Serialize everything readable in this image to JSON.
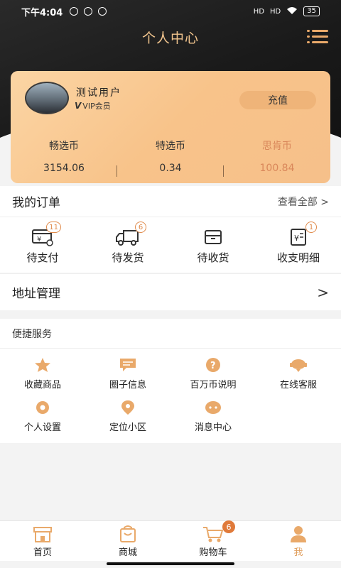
{
  "status": {
    "time": "下午4:04",
    "battery": "35",
    "signal1": "HD",
    "signal2": "HD"
  },
  "header": {
    "title": "个人中心"
  },
  "colors": {
    "accent": "#e9a96a",
    "card": "#f8c38a",
    "third_coin": "#d9875a",
    "badge": "#e07a3a"
  },
  "user": {
    "name": "测试用户",
    "vip_label": "VIP会员",
    "recharge_label": "充值"
  },
  "coins": [
    {
      "name": "畅选币",
      "value": "3154.06"
    },
    {
      "name": "特选币",
      "value": "0.34"
    },
    {
      "name": "思肯币",
      "value": "100.84"
    }
  ],
  "orders": {
    "title": "我的订单",
    "view_all": "查看全部 >",
    "items": [
      {
        "label": "待支付",
        "badge": "11",
        "icon": "wallet-icon"
      },
      {
        "label": "待发货",
        "badge": "6",
        "icon": "truck-icon"
      },
      {
        "label": "待收货",
        "badge": "",
        "icon": "package-icon"
      },
      {
        "label": "收支明细",
        "badge": "1",
        "icon": "ledger-icon"
      }
    ]
  },
  "address": {
    "label": "地址管理",
    "chevron": ">"
  },
  "services": {
    "title": "便捷服务",
    "items": [
      {
        "label": "收藏商品",
        "icon": "star-icon"
      },
      {
        "label": "圈子信息",
        "icon": "chat-icon"
      },
      {
        "label": "百万币说明",
        "icon": "question-icon"
      },
      {
        "label": "在线客服",
        "icon": "headset-icon"
      },
      {
        "label": "个人设置",
        "icon": "gear-icon"
      },
      {
        "label": "定位小区",
        "icon": "location-icon"
      },
      {
        "label": "消息中心",
        "icon": "message-icon"
      }
    ]
  },
  "tabbar": {
    "items": [
      {
        "label": "首页",
        "icon": "shop-icon"
      },
      {
        "label": "商城",
        "icon": "bag-icon"
      },
      {
        "label": "购物车",
        "icon": "cart-icon",
        "badge": "6"
      },
      {
        "label": "我",
        "icon": "user-icon"
      }
    ]
  }
}
